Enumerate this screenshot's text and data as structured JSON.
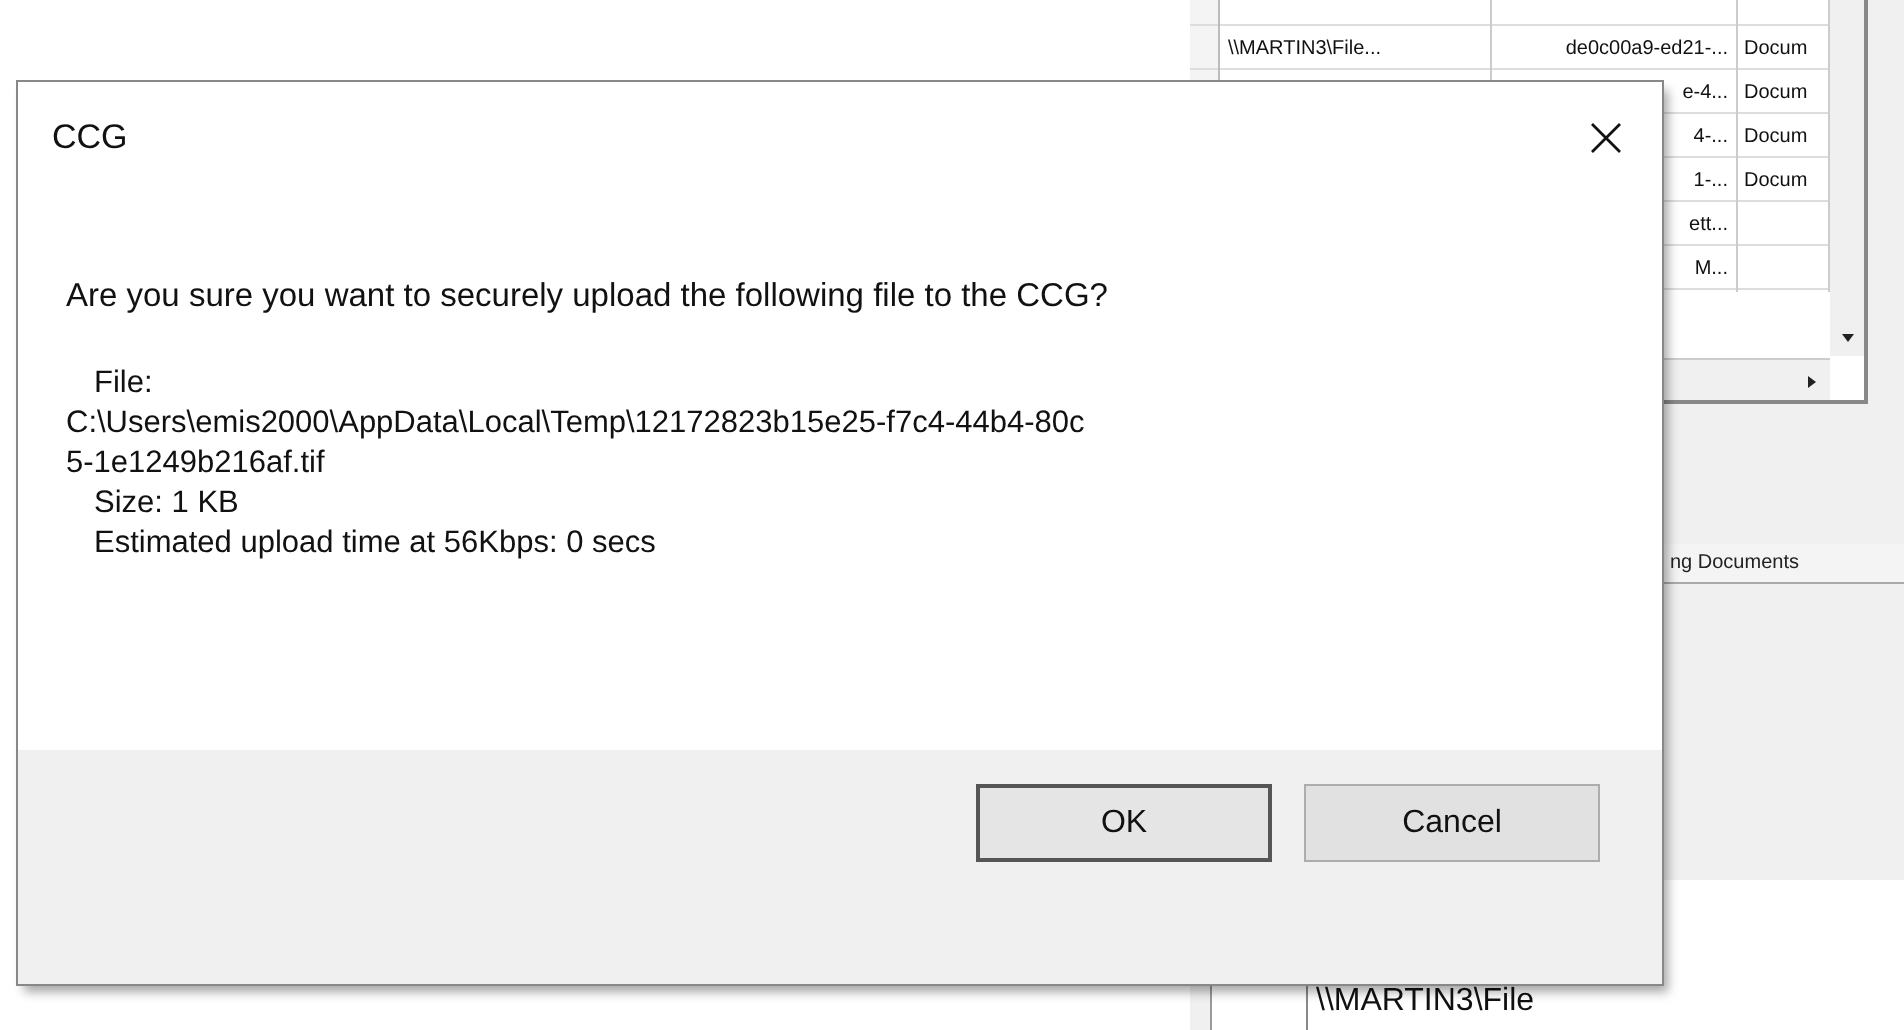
{
  "background_window": {
    "grid_rows": [
      {
        "cells": [
          "\\\\MARTIN3\\File...",
          "de0c00a9-ed21-...",
          "Docum"
        ]
      },
      {
        "cells": [
          "",
          "e-4...",
          "Docum"
        ]
      },
      {
        "cells": [
          "",
          "4-...",
          "Docum"
        ]
      },
      {
        "cells": [
          "",
          "1-...",
          "Docum"
        ]
      },
      {
        "cells": [
          "",
          "ett...",
          ""
        ]
      },
      {
        "cells": [
          "",
          "M...",
          ""
        ]
      }
    ],
    "tab_label": "ng Documents",
    "lower_grid_rows": [
      "\\\\MARTIN3\\File"
    ]
  },
  "dialog": {
    "title": "CCG",
    "message": "Are you sure you want to securely upload the following file to the CCG?",
    "details": [
      "File:",
      "C:\\Users\\emis2000\\AppData\\Local\\Temp\\12172823b15e25-f7c4-44b4-80c",
      "5-1e1249b216af.tif",
      "Size: 1 KB",
      "Estimated upload time at 56Kbps: 0 secs"
    ],
    "buttons": [
      {
        "label": "OK",
        "kind": "default"
      },
      {
        "label": "Cancel",
        "kind": "normal"
      }
    ]
  }
}
